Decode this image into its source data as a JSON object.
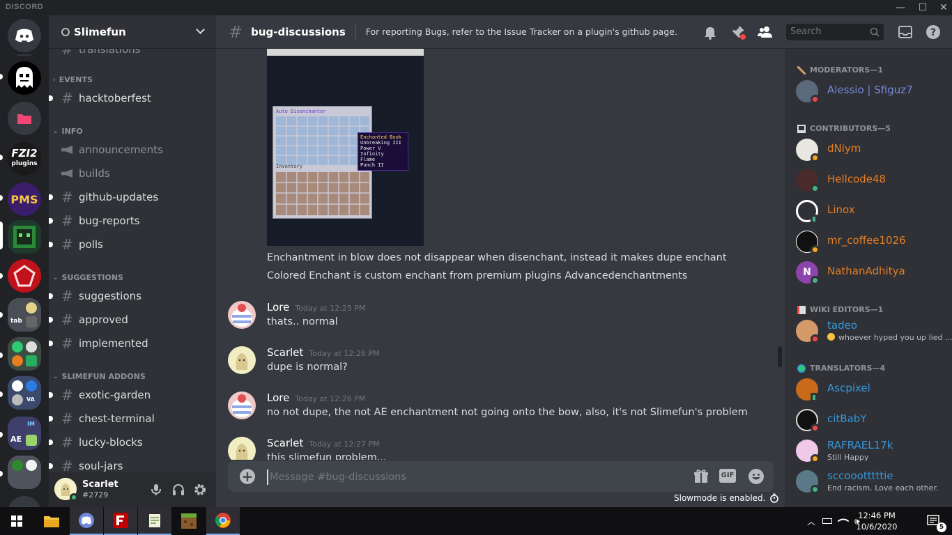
{
  "app": {
    "brand": "DISCORD"
  },
  "window_controls": {
    "minimize": "—",
    "maximize": "☐",
    "close": "✕"
  },
  "server": {
    "name": "Slimefun"
  },
  "channels": {
    "partial_top": "translations",
    "categories": [
      {
        "label": "EVENTS",
        "items": [
          {
            "name": "hacktoberfest"
          }
        ]
      },
      {
        "label": "INFO",
        "items": [
          {
            "name": "announcements"
          },
          {
            "name": "builds"
          },
          {
            "name": "github-updates"
          },
          {
            "name": "bug-reports"
          },
          {
            "name": "polls"
          }
        ]
      },
      {
        "label": "SUGGESTIONS",
        "items": [
          {
            "name": "suggestions"
          },
          {
            "name": "approved"
          },
          {
            "name": "implemented"
          }
        ]
      },
      {
        "label": "SLIMEFUN ADDONS",
        "items": [
          {
            "name": "exotic-garden"
          },
          {
            "name": "chest-terminal"
          },
          {
            "name": "lucky-blocks"
          },
          {
            "name": "soul-jars"
          }
        ]
      }
    ]
  },
  "user": {
    "name": "Scarlet",
    "tag": "#2729"
  },
  "guild_labels": {
    "fzi": "FZI2",
    "fzi_sub": "plugins",
    "pms": "PMS",
    "ae": "AE",
    "tab": "tab",
    "va": "VA",
    "im": "IM"
  },
  "channel_header": {
    "name": "bug-discussions",
    "topic": "For reporting Bugs, refer to the Issue Tracker on a plugin's github page.",
    "search_placeholder": "Search"
  },
  "attachment": {
    "window_title": "Auto Disenchanter",
    "inventory_label": "Inventory",
    "tooltip_title": "Enchanted Book",
    "tooltip_lines": [
      "Unbreaking III",
      "Power V",
      "Infinity",
      "Flame",
      "Punch II"
    ]
  },
  "messages": {
    "continued": [
      "Enchantment in blow does not disappear when disenchant, instead it makes dupe enchant",
      "Colored Enchant is custom enchant from premium plugins Advancedenchantments"
    ],
    "list": [
      {
        "author": "Lore",
        "time": "Today at 12:25 PM",
        "text": "thats.. normal"
      },
      {
        "author": "Scarlet",
        "time": "Today at 12:26 PM",
        "text": "dupe is normal?"
      },
      {
        "author": "Lore",
        "time": "Today at 12:26 PM",
        "text": "no not dupe, the not AE enchantment not going onto the bow, also, it's not Slimefun's problem"
      },
      {
        "author": "Scarlet",
        "time": "Today at 12:27 PM",
        "text": "this slimefun problem..."
      }
    ]
  },
  "composer": {
    "placeholder": "Message #bug-discussions",
    "gif_label": "GIF",
    "slowmode": "Slowmode is enabled."
  },
  "members": {
    "groups": [
      {
        "label": "MODERATORS—1",
        "items": [
          {
            "name": "Alessio | Sfiguz7",
            "color": "#7289da",
            "status": "dnd"
          }
        ]
      },
      {
        "label": "CONTRIBUTORS—5",
        "items": [
          {
            "name": "dNiym",
            "color": "#e67e22",
            "status": "idle"
          },
          {
            "name": "Hellcode48",
            "color": "#e67e22",
            "status": "online"
          },
          {
            "name": "Linox",
            "color": "#e67e22",
            "status": "mobile"
          },
          {
            "name": "mr_coffee1026",
            "color": "#e67e22",
            "status": "idle"
          },
          {
            "name": "NathanAdhitya",
            "color": "#e67e22",
            "status": "online",
            "initial": "N"
          }
        ]
      },
      {
        "label": "WIKI EDITORS—1",
        "items": [
          {
            "name": "tadeo",
            "color": "#3498db",
            "status": "dnd",
            "activity": "whoever hyped you up lied ..."
          }
        ]
      },
      {
        "label": "TRANSLATORS—4",
        "items": [
          {
            "name": "Ascpixel",
            "color": "#3498db",
            "status": "mobile"
          },
          {
            "name": "citBabY",
            "color": "#3498db",
            "status": "dnd"
          },
          {
            "name": "RAFRAEL17k",
            "color": "#3498db",
            "status": "idle",
            "activity": "Still Happy"
          },
          {
            "name": "sccoootttttie",
            "color": "#3498db",
            "status": "online",
            "activity": "End racism. Love each other."
          }
        ]
      }
    ]
  },
  "taskbar": {
    "time": "12:46 PM",
    "date": "10/6/2020",
    "notification_count": "5"
  },
  "colors": {
    "accent": "#7289da",
    "online": "#43b581",
    "idle": "#faa61a",
    "dnd": "#f04747",
    "background": "#36393f"
  }
}
